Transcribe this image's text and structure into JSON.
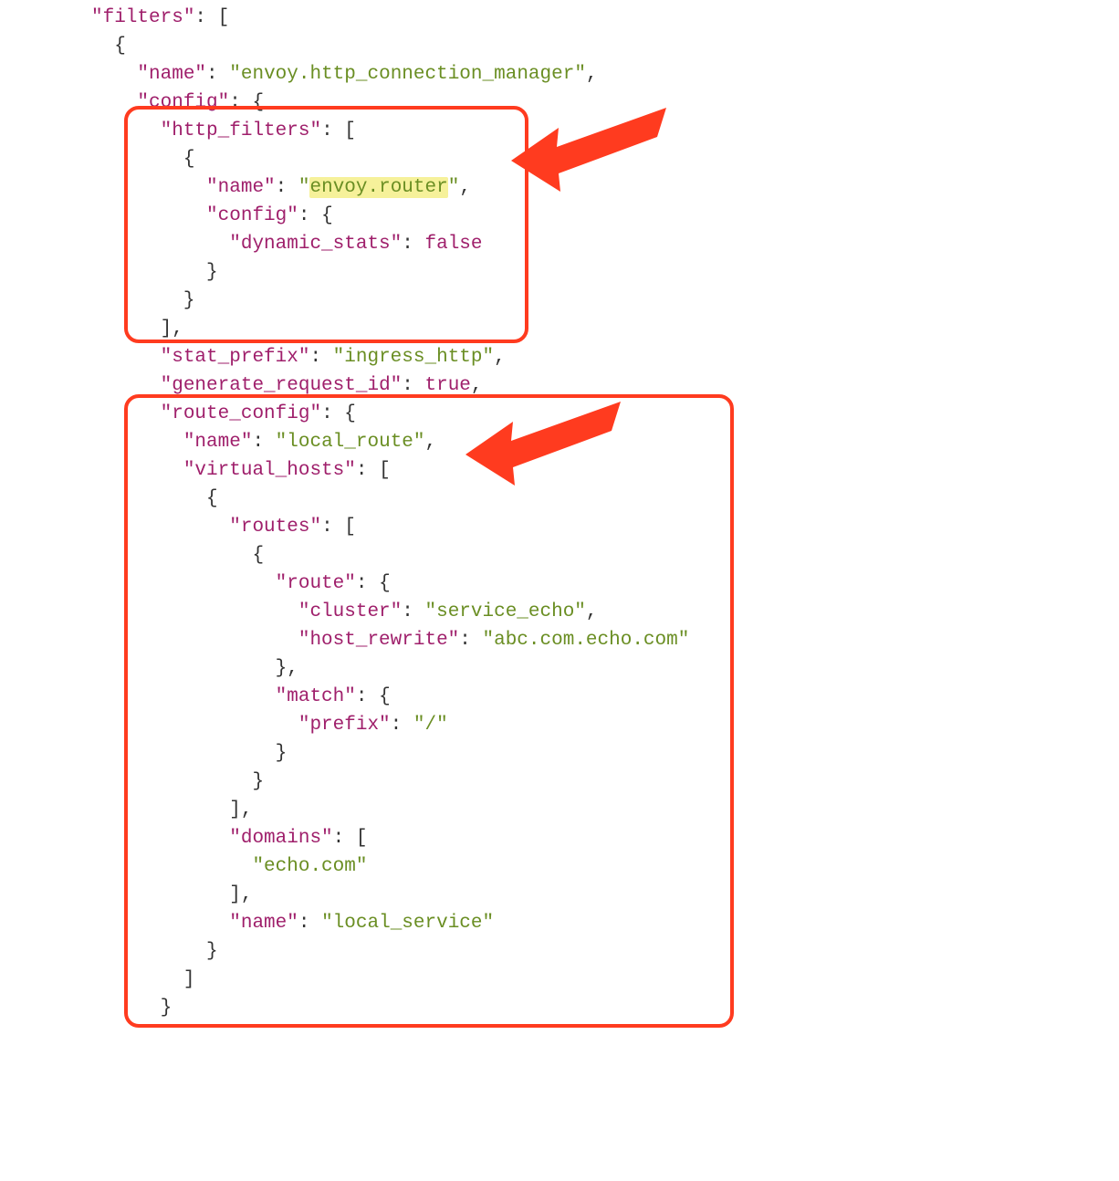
{
  "json": {
    "filters": [
      {
        "name": "envoy.http_connection_manager",
        "config": {
          "http_filters": [
            {
              "name": "envoy.router",
              "config": {
                "dynamic_stats": false
              }
            }
          ],
          "stat_prefix": "ingress_http",
          "generate_request_id": true,
          "route_config": {
            "name": "local_route",
            "virtual_hosts": [
              {
                "routes": [
                  {
                    "route": {
                      "cluster": "service_echo",
                      "host_rewrite": "abc.com.echo.com"
                    },
                    "match": {
                      "prefix": "/"
                    }
                  }
                ],
                "domains": [
                  "echo.com"
                ],
                "name": "local_service"
              }
            ]
          }
        }
      }
    ]
  },
  "tokens": {
    "k_filters": "\"filters\"",
    "k_name": "\"name\"",
    "k_config": "\"config\"",
    "k_http_filters": "\"http_filters\"",
    "k_dynamic_stats": "\"dynamic_stats\"",
    "k_stat_prefix": "\"stat_prefix\"",
    "k_generate_request_id": "\"generate_request_id\"",
    "k_route_config": "\"route_config\"",
    "k_virtual_hosts": "\"virtual_hosts\"",
    "k_routes": "\"routes\"",
    "k_route": "\"route\"",
    "k_cluster": "\"cluster\"",
    "k_host_rewrite": "\"host_rewrite\"",
    "k_match": "\"match\"",
    "k_prefix": "\"prefix\"",
    "k_domains": "\"domains\"",
    "v_envoy_http": "\"envoy.http_connection_manager\"",
    "v_envoy_router_q1": "\"",
    "v_envoy_router": "envoy.router",
    "v_envoy_router_q2": "\"",
    "v_false": "false",
    "v_ingress": "\"ingress_http\"",
    "v_true": "true",
    "v_local_route": "\"local_route\"",
    "v_service_echo": "\"service_echo\"",
    "v_host_rewrite": "\"abc.com.echo.com\"",
    "v_slash": "\"/\"",
    "v_echo": "\"echo.com\"",
    "v_local_service": "\"local_service\""
  },
  "annotations": {
    "box1": {
      "purpose": "http_filters block"
    },
    "box2": {
      "purpose": "route_config block"
    },
    "arrow_color": "#FF3B1F"
  }
}
